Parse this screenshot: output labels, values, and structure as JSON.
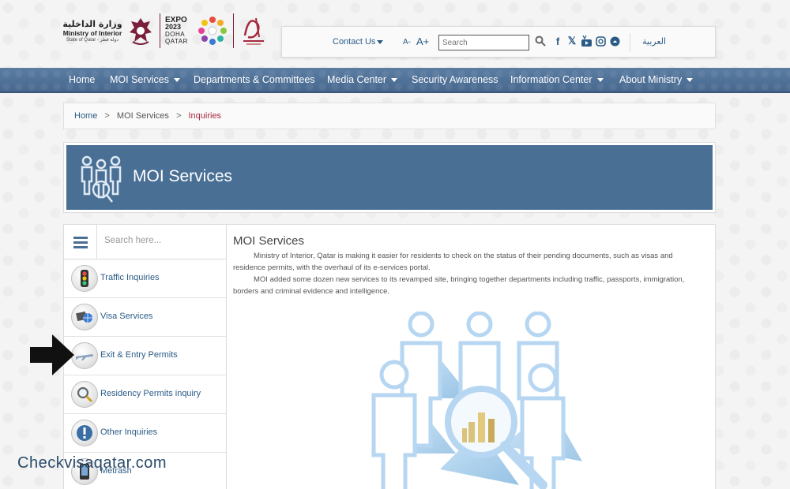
{
  "header": {
    "moi_arabic": "وزارة الداخلية",
    "moi_english": "Ministry of Interior",
    "moi_sub": "State of Qatar - دولة قطر",
    "expo": {
      "line1": "EXPO",
      "line2": "2023",
      "line3": "DOHA",
      "line4": "QATAR"
    }
  },
  "topbar": {
    "contact_label": "Contact Us",
    "font_minus": "A-",
    "font_plus": "A+",
    "search_placeholder": "Search",
    "social_icons": [
      "facebook-icon",
      "x-icon",
      "youtube-icon",
      "instagram-icon",
      "snapchat-icon"
    ],
    "language_label": "العربية"
  },
  "nav": {
    "items": [
      {
        "label": "Home",
        "has_dropdown": false
      },
      {
        "label": "MOI Services",
        "has_dropdown": true
      },
      {
        "label": "Departments & Committees",
        "has_dropdown": false
      },
      {
        "label": "Media Center",
        "has_dropdown": true
      },
      {
        "label": "Security Awareness",
        "has_dropdown": false
      },
      {
        "label": "Information Center",
        "has_dropdown": true
      },
      {
        "label": "About Ministry",
        "has_dropdown": true
      }
    ]
  },
  "breadcrumb": {
    "items": [
      "Home",
      "MOI Services"
    ],
    "current": "Inquiries",
    "separator": ">"
  },
  "banner": {
    "title": "MOI Services"
  },
  "sidebar": {
    "search_placeholder": "Search here...",
    "items": [
      {
        "label": "Traffic Inquiries",
        "icon": "traffic-light-icon"
      },
      {
        "label": "Visa Services",
        "icon": "visa-globe-icon"
      },
      {
        "label": "Exit & Entry Permits",
        "icon": "airplane-icon"
      },
      {
        "label": "Residency Permits inquiry",
        "icon": "magnifier-icon"
      },
      {
        "label": "Other Inquiries",
        "icon": "exclamation-icon"
      },
      {
        "label": "Metrash",
        "icon": "phone-icon"
      }
    ]
  },
  "content": {
    "title": "MOI Services",
    "paragraph1": "Ministry of Interior, Qatar is making it easier for residents to check on the status of their pending documents, such as visas and residence permits, with the overhaul of its e-services portal.",
    "paragraph2": "MOI added some dozen new services to its revamped site, bringing together departments including traffic, passports, immigration, borders and criminal evidence and intelligence."
  },
  "watermark": "Checkvisaqatar.com",
  "colors": {
    "nav_blue": "#4a6f95",
    "link_blue": "#2a5b86",
    "breadcrumb_current": "#a62a3e",
    "maroon": "#7a1f3a"
  }
}
